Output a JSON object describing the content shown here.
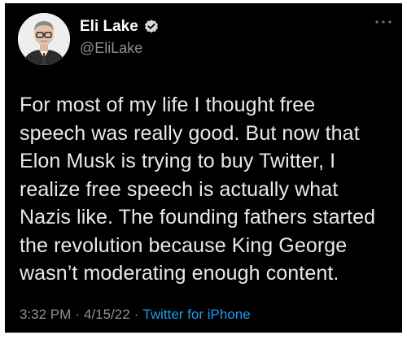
{
  "user": {
    "display_name": "Eli Lake",
    "handle": "@EliLake",
    "verified": true,
    "avatar_icon": "portrait-avatar"
  },
  "more_icon": "more-options-icon",
  "tweet": {
    "text_lines": [
      "For most of my life I thought free",
      "speech was really good. But now that",
      "Elon Musk is trying to buy Twitter, I",
      "realize free speech is actually what",
      "Nazis like. The founding fathers started",
      "the revolution because King George",
      "wasn’t moderating enough content."
    ],
    "time": "3:32 PM",
    "separator": "·",
    "date": "4/15/22",
    "source": "Twitter for iPhone"
  },
  "colors": {
    "background": "#000000",
    "text": "#e7e9ea",
    "secondary_text": "#8b9096",
    "link": "#1d9bf0",
    "verified_badge": "#1d9bf0"
  }
}
